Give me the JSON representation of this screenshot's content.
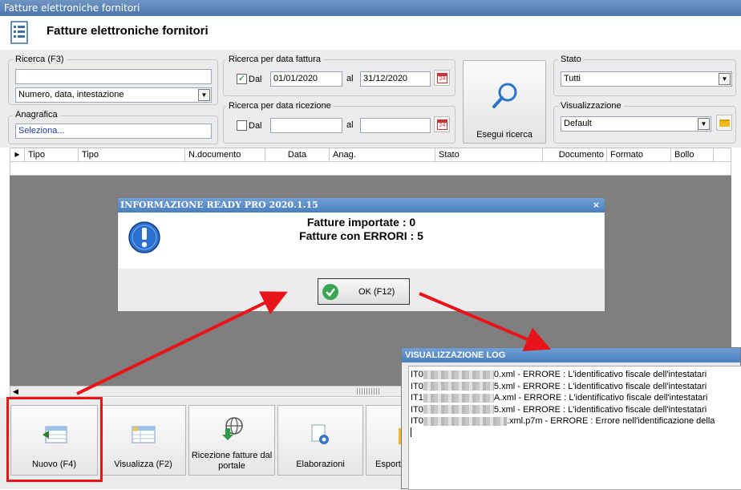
{
  "window": {
    "title": "Fatture elettroniche fornitori"
  },
  "header": {
    "title": "Fatture elettroniche fornitori"
  },
  "search": {
    "ricerca_label": "Ricerca (F3)",
    "ricerca_value": "",
    "ricerca_mode": "Numero, data, intestazione",
    "anagrafica_label": "Anagrafica",
    "anagrafica_value": "Seleziona...",
    "data_fattura_label": "Ricerca per data fattura",
    "data_fattura_dal_label": "Dal",
    "data_fattura_dal": "01/01/2020",
    "data_fattura_al_label": "al",
    "data_fattura_al": "31/12/2020",
    "data_fattura_checked": true,
    "data_ricezione_label": "Ricerca per data ricezione",
    "data_ricezione_dal_label": "Dal",
    "data_ricezione_dal": "",
    "data_ricezione_al_label": "al",
    "data_ricezione_al": "",
    "data_ricezione_checked": false,
    "calendar_day": "24",
    "search_button_label": "Esegui ricerca",
    "stato_label": "Stato",
    "stato_value": "Tutti",
    "visualizzazione_label": "Visualizzazione",
    "visualizzazione_value": "Default"
  },
  "grid": {
    "columns": [
      "Tipo",
      "Tipo",
      "N.documento",
      "Data",
      "Anag.",
      "Stato",
      "Documento",
      "Formato",
      "Bollo"
    ]
  },
  "dialog": {
    "title": "INFORMAZIONE READY PRO 2020.1.15",
    "line1": "Fatture importate : 0",
    "line2": "Fatture con ERRORI : 5",
    "ok_label": "OK (F12)",
    "close": "×"
  },
  "log": {
    "title": "VISUALIZZAZIONE LOG",
    "lines": [
      {
        "prefix": "IT0",
        "suffix": "0.xml - ERRORE : L'identificativo fiscale dell'intestatari"
      },
      {
        "prefix": "IT0",
        "suffix": "5.xml - ERRORE : L'identificativo fiscale dell'intestatari"
      },
      {
        "prefix": "IT1",
        "suffix": "A.xml - ERRORE : L'identificativo fiscale dell'intestatari"
      },
      {
        "prefix": "IT0",
        "suffix": "5.xml - ERRORE : L'identificativo fiscale dell'intestatari"
      },
      {
        "prefix": "IT0",
        "suffix": ".xml.p7m - ERRORE : Errore nell'identificazione della"
      }
    ]
  },
  "toolbar": {
    "nuovo": "Nuovo (F4)",
    "visualizza": "Visualizza (F2)",
    "ricezione": "Ricezione fatture dal portale",
    "elaborazioni": "Elaborazioni",
    "esporta": "Esport"
  },
  "colors": {
    "title_bar": "#4d77ad",
    "dialog_title": "#4a7fc0",
    "annotation": "#e8141a",
    "gray_area": "#7f7f7f"
  }
}
